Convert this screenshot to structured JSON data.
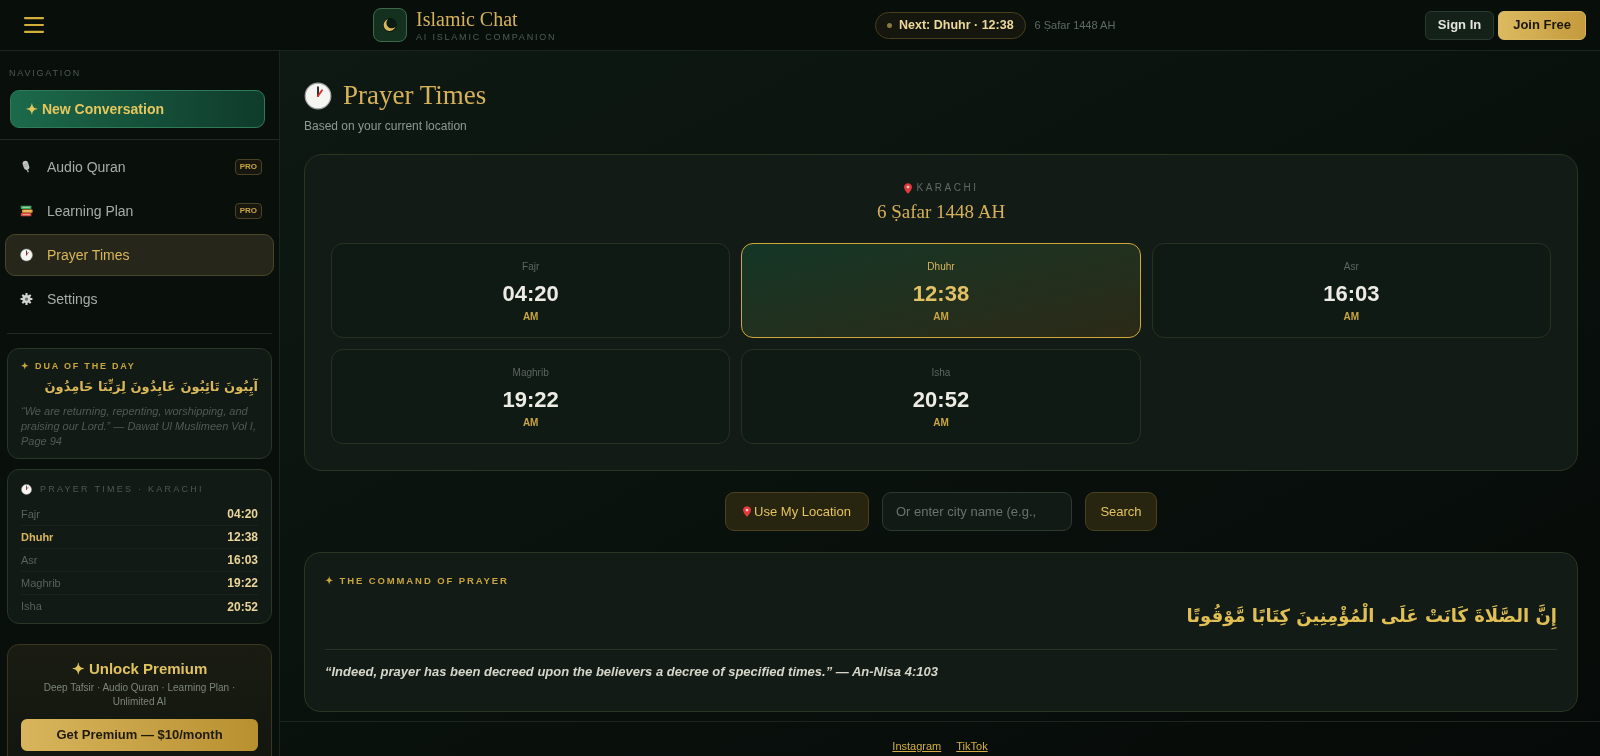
{
  "header": {
    "brand": {
      "name": "Islamic Chat",
      "tagline": "AI ISLAMIC COMPANION"
    },
    "next_prayer": "Next: Dhuhr · 12:38",
    "hijri_date": "6 Ṣafar 1448 AH",
    "buttons": [
      {
        "label": "Sign In",
        "kind": "secondary"
      },
      {
        "label": "Join Free",
        "kind": "primary"
      }
    ]
  },
  "sidebar": {
    "section_label": "NAVIGATION",
    "new_conversation": "✦ New Conversation",
    "items": [
      {
        "label": "Audio Quran",
        "kind": "audio",
        "badge": "PRO",
        "selected": false
      },
      {
        "label": "Learning Plan",
        "kind": "plan",
        "badge": "PRO",
        "selected": false
      },
      {
        "label": "Prayer Times",
        "kind": "prayer",
        "selected": true
      },
      {
        "label": "Settings",
        "kind": "settings",
        "selected": false
      }
    ],
    "dua": {
      "title": "✦ DUA OF THE DAY",
      "arabic": "آيِبُونَ تَائِبُونَ عَابِدُونَ لِرَبِّنَا حَامِدُونَ",
      "translation": "“We are returning, repenting, worshipping, and praising our Lord.” — Dawat Ul Muslimeen Vol I, Page 94"
    },
    "prayer_widget": {
      "title": "PRAYER TIMES · KARACHI",
      "rows": [
        {
          "name": "Fajr",
          "time": "04:20",
          "selected": false
        },
        {
          "name": "Dhuhr",
          "time": "12:38",
          "selected": true
        },
        {
          "name": "Asr",
          "time": "16:03",
          "selected": false
        },
        {
          "name": "Maghrib",
          "time": "19:22",
          "selected": false
        },
        {
          "name": "Isha",
          "time": "20:52",
          "selected": false
        }
      ]
    },
    "premium": {
      "title": "✦ Unlock Premium",
      "features": "Deep Tafsir · Audio Quran · Learning Plan · Unlimited AI",
      "button": "Get Premium — $10/month"
    }
  },
  "main": {
    "title": "Prayer Times",
    "subtitle": "Based on your current location",
    "prayer_card": {
      "location": "KARACHI",
      "date": "6 Ṣafar 1448 AH",
      "prayers": [
        {
          "name": "Fajr",
          "time": "04:20",
          "period": "AM",
          "selected": false
        },
        {
          "name": "Dhuhr",
          "time": "12:38",
          "period": "AM",
          "selected": true
        },
        {
          "name": "Asr",
          "time": "16:03",
          "period": "AM",
          "selected": false
        },
        {
          "name": "Maghrib",
          "time": "19:22",
          "period": "AM",
          "selected": false
        },
        {
          "name": "Isha",
          "time": "20:52",
          "period": "AM",
          "selected": false
        }
      ]
    },
    "location_controls": {
      "use_location": "Use My Location",
      "city_field": {
        "placeholder": "Or enter city name (e.g.,"
      },
      "search": "Search"
    },
    "command": {
      "title": "✦ THE COMMAND OF PRAYER",
      "arabic": "إِنَّ الصَّلَاةَ كَانَتْ عَلَى الْمُؤْمِنِينَ كِتَابًا مَّوْقُوتًا",
      "translation": "“Indeed, prayer has been decreed upon the believers a decree of specified times.” — An-Nisa 4:103"
    }
  },
  "footer": {
    "links": [
      "Instagram",
      "TikTok"
    ]
  }
}
